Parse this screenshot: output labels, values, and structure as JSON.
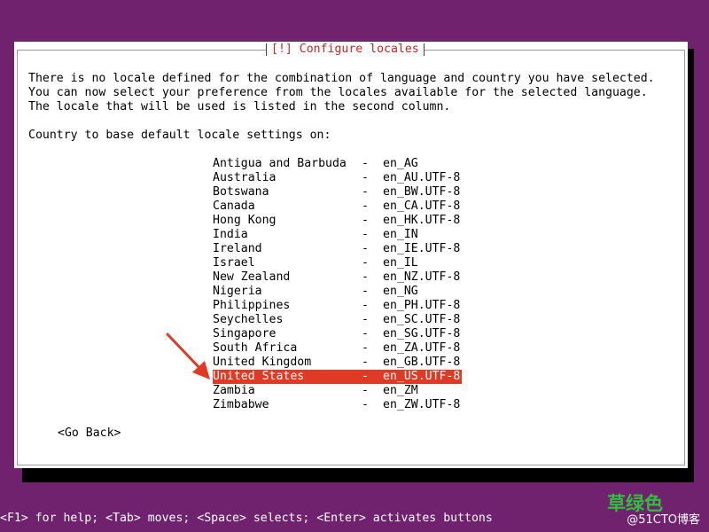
{
  "dialog": {
    "title": "[!] Configure locales",
    "intro_lines": [
      "There is no locale defined for the combination of language and country you have selected.",
      "You can now select your preference from the locales available for the selected language.",
      "The locale that will be used is listed in the second column."
    ],
    "prompt": "Country to base default locale settings on:",
    "items": [
      {
        "country": "Antigua and Barbuda",
        "locale": "en_AG"
      },
      {
        "country": "Australia",
        "locale": "en_AU.UTF-8"
      },
      {
        "country": "Botswana",
        "locale": "en_BW.UTF-8"
      },
      {
        "country": "Canada",
        "locale": "en_CA.UTF-8"
      },
      {
        "country": "Hong Kong",
        "locale": "en_HK.UTF-8"
      },
      {
        "country": "India",
        "locale": "en_IN"
      },
      {
        "country": "Ireland",
        "locale": "en_IE.UTF-8"
      },
      {
        "country": "Israel",
        "locale": "en_IL"
      },
      {
        "country": "New Zealand",
        "locale": "en_NZ.UTF-8"
      },
      {
        "country": "Nigeria",
        "locale": "en_NG"
      },
      {
        "country": "Philippines",
        "locale": "en_PH.UTF-8"
      },
      {
        "country": "Seychelles",
        "locale": "en_SC.UTF-8"
      },
      {
        "country": "Singapore",
        "locale": "en_SG.UTF-8"
      },
      {
        "country": "South Africa",
        "locale": "en_ZA.UTF-8"
      },
      {
        "country": "United Kingdom",
        "locale": "en_GB.UTF-8"
      },
      {
        "country": "United States",
        "locale": "en_US.UTF-8",
        "selected": true
      },
      {
        "country": "Zambia",
        "locale": "en_ZM"
      },
      {
        "country": "Zimbabwe",
        "locale": "en_ZW.UTF-8"
      }
    ],
    "separator": "-",
    "go_back_label": "<Go Back>"
  },
  "footer": {
    "help_text": "<F1> for help; <Tab> moves; <Space> selects; <Enter> activates buttons"
  },
  "watermark": {
    "brand": "草绿色",
    "site": "@51CTO博客"
  },
  "colors": {
    "background": "#70226f",
    "title": "#c62626",
    "selection": "#e03a25",
    "annotation_arrow": "#e03a25"
  }
}
